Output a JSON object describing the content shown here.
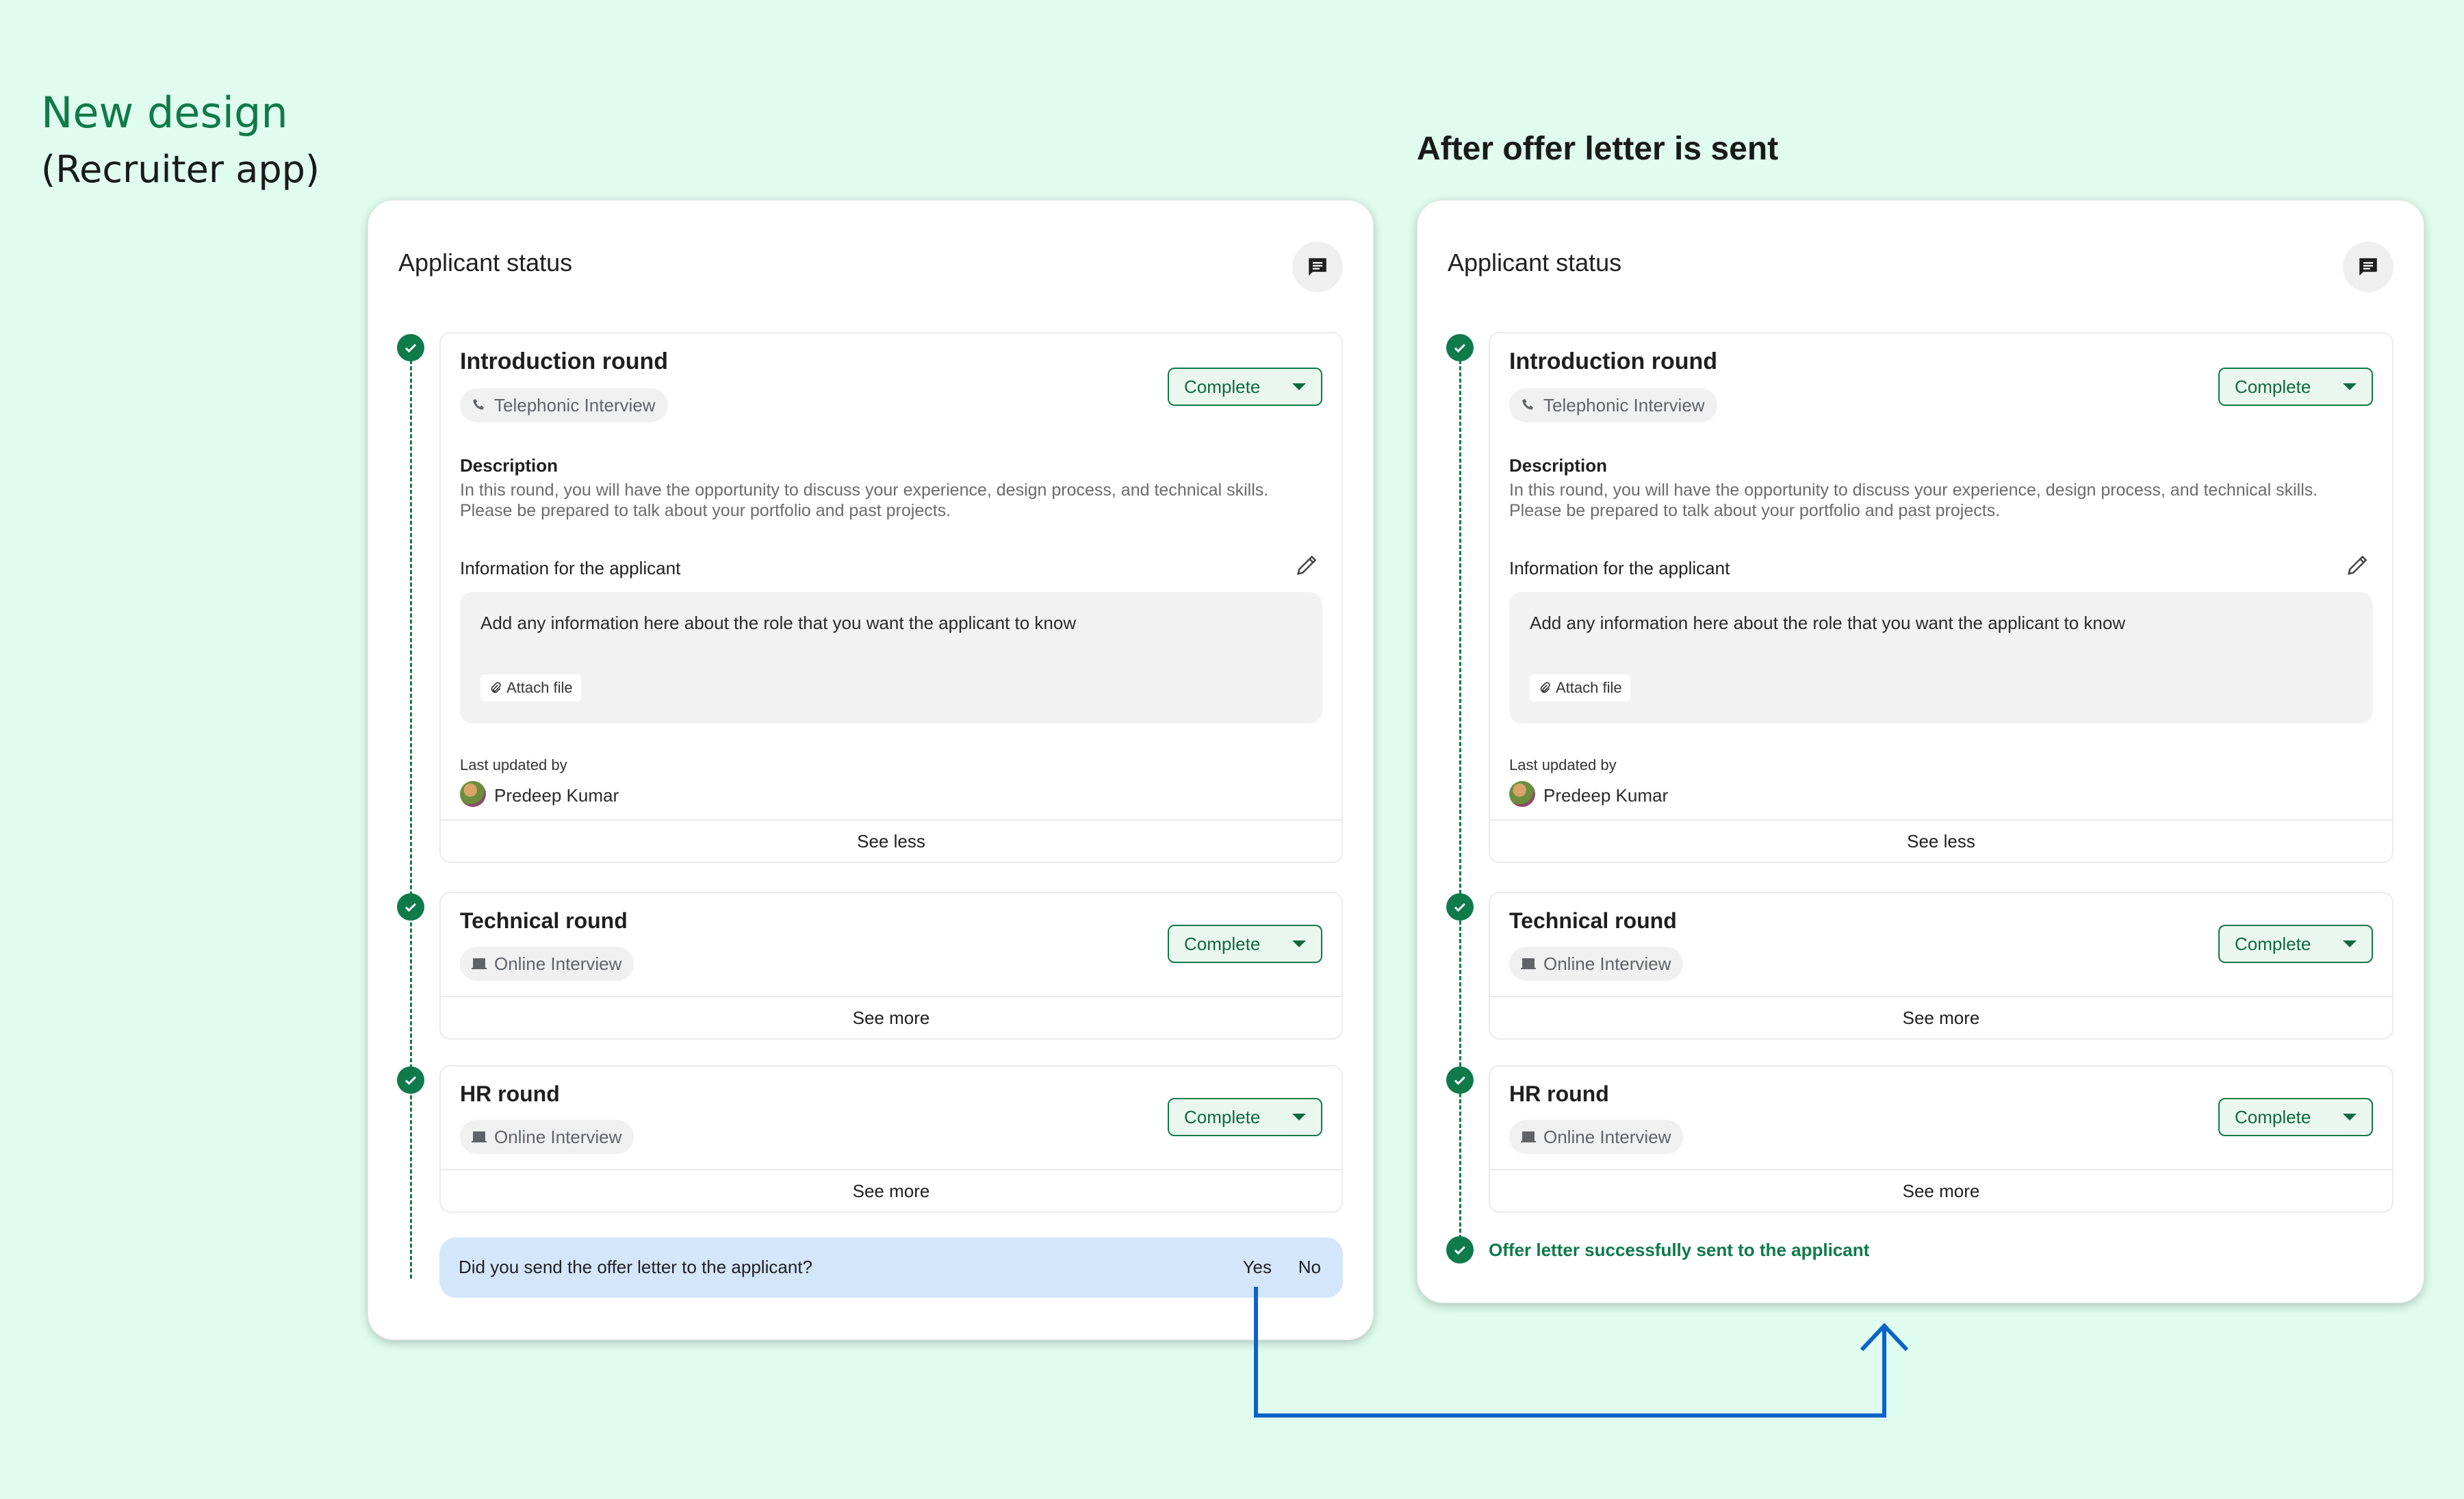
{
  "page": {
    "title": "New design",
    "subtitle": "(Recruiter app)",
    "right_heading": "After offer letter is sent"
  },
  "colors": {
    "accent": "#0f7a4a",
    "background": "#dffcef",
    "question_bg": "#d3e6fb",
    "arrow": "#0a63c9"
  },
  "before": {
    "panel_title": "Applicant status",
    "chat_icon": "chat-icon",
    "rounds": [
      {
        "title": "Introduction round",
        "type": "Telephonic Interview",
        "type_icon": "phone-icon",
        "status": "Complete",
        "description_label": "Description",
        "description_line1": "In this round, you will have the opportunity to discuss your experience, design process, and technical skills.",
        "description_line2": "Please be prepared to talk about your portfolio and past projects.",
        "info_label": "Information for the applicant",
        "info_placeholder": "Add any information here about the role that you want the applicant to know",
        "attach_label": "Attach file",
        "last_updated_label": "Last updated by",
        "last_updated_user": "Predeep Kumar",
        "footer": "See less"
      },
      {
        "title": "Technical round",
        "type": "Online Interview",
        "type_icon": "laptop-icon",
        "status": "Complete",
        "footer": "See more"
      },
      {
        "title": "HR round",
        "type": "Online Interview",
        "type_icon": "laptop-icon",
        "status": "Complete",
        "footer": "See more"
      }
    ],
    "question": {
      "text": "Did you send the offer letter to the applicant?",
      "yes": "Yes",
      "no": "No"
    }
  },
  "after": {
    "panel_title": "Applicant status",
    "chat_icon": "chat-icon",
    "rounds": [
      {
        "title": "Introduction round",
        "type": "Telephonic Interview",
        "type_icon": "phone-icon",
        "status": "Complete",
        "description_label": "Description",
        "description_line1": "In this round, you will have the opportunity to discuss your experience, design process, and technical skills.",
        "description_line2": "Please be prepared to talk about your portfolio and past projects.",
        "info_label": "Information for the applicant",
        "info_placeholder": "Add any information here about the role that you want the applicant to know",
        "attach_label": "Attach file",
        "last_updated_label": "Last updated by",
        "last_updated_user": "Predeep Kumar",
        "footer": "See less"
      },
      {
        "title": "Technical round",
        "type": "Online Interview",
        "type_icon": "laptop-icon",
        "status": "Complete",
        "footer": "See more"
      },
      {
        "title": "HR round",
        "type": "Online Interview",
        "type_icon": "laptop-icon",
        "status": "Complete",
        "footer": "See more"
      }
    ],
    "success_message": "Offer letter successfully sent to the applicant"
  }
}
